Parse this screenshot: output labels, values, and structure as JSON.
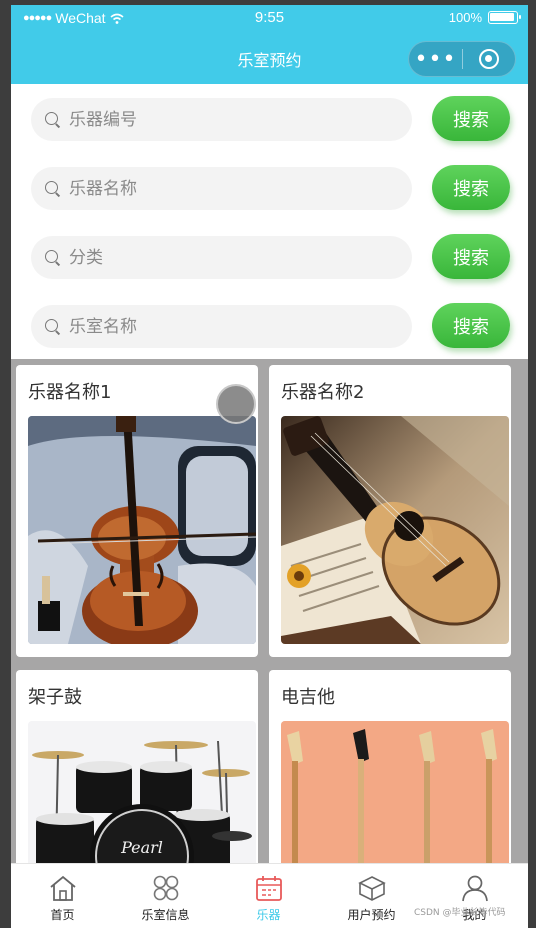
{
  "status_bar": {
    "carrier": "WeChat",
    "time": "9:55",
    "battery": "100%"
  },
  "nav": {
    "title": "乐室预约",
    "more_icon": "more-dots-icon",
    "close_icon": "target-circle-icon"
  },
  "search": {
    "button_label": "搜索",
    "fields": [
      {
        "placeholder": "乐器编号"
      },
      {
        "placeholder": "乐器名称"
      },
      {
        "placeholder": "分类"
      },
      {
        "placeholder": "乐室名称"
      }
    ]
  },
  "cards": [
    {
      "title": "乐器名称1",
      "image": "violin-image"
    },
    {
      "title": "乐器名称2",
      "image": "acoustic-guitar-image"
    },
    {
      "title": "架子鼓",
      "image": "drum-kit-image"
    },
    {
      "title": "电吉他",
      "image": "electric-guitars-image"
    }
  ],
  "tabbar": {
    "items": [
      {
        "label": "首页",
        "icon": "home-icon"
      },
      {
        "label": "乐室信息",
        "icon": "grid-flower-icon"
      },
      {
        "label": "乐器",
        "icon": "calendar-icon",
        "active": true
      },
      {
        "label": "用户预约",
        "icon": "box-icon"
      },
      {
        "label": "我的",
        "icon": "user-icon"
      }
    ]
  },
  "watermark": "CSDN @毕业长毕代码",
  "colors": {
    "accent": "#41cbe9",
    "button_green": "#4cc64a",
    "active_tab_icon": "#e85a5a"
  }
}
